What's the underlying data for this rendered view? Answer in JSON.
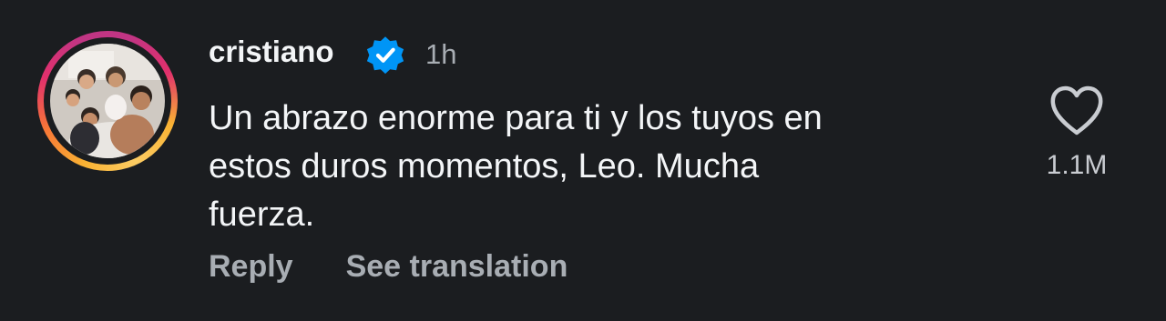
{
  "comment": {
    "username": "cristiano",
    "verified_icon": "verified-badge-icon",
    "timestamp": "1h",
    "text": "Un abrazo enorme para ti y los tuyos en\nestos duros momentos, Leo. Mucha\nfuerza.",
    "like_icon": "heart-outline-icon",
    "like_count": "1.1M"
  },
  "actions": {
    "reply_label": "Reply",
    "translate_label": "See translation"
  },
  "colors": {
    "background": "#1b1d20",
    "text_primary": "#f3f5f7",
    "text_secondary": "#a8adb3",
    "verified_blue": "#0095f6"
  }
}
